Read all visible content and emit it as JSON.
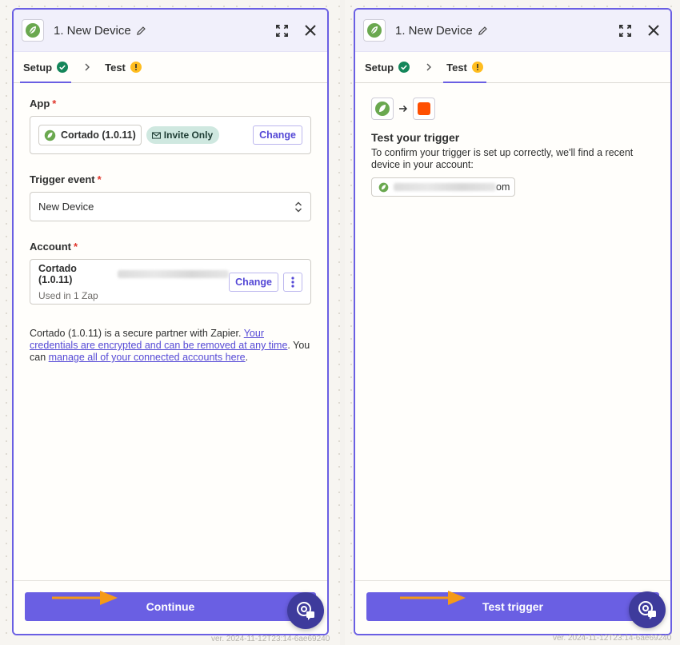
{
  "colors": {
    "accent": "#6a5fe3",
    "success": "#14865a",
    "warning": "#ffbd1f",
    "brand_green": "#6aa84f",
    "orange_app": "#ff4f00",
    "annotation_arrow": "#f59a18"
  },
  "left_panel": {
    "header": {
      "title": "1. New Device",
      "expand_icon": "expand-icon",
      "close_icon": "close-icon"
    },
    "tabs": [
      {
        "label": "Setup",
        "status": "complete"
      },
      {
        "label": "Test",
        "status": "warning"
      }
    ],
    "app": {
      "label": "App",
      "name": "Cortado (1.0.11)",
      "badge": "Invite Only",
      "change_label": "Change"
    },
    "trigger": {
      "label": "Trigger event",
      "value": "New Device"
    },
    "account": {
      "label": "Account",
      "name": "Cortado (1.0.11)",
      "usage": "Used in 1 Zap",
      "change_label": "Change"
    },
    "info": {
      "text_1": "Cortado (1.0.11) is a secure partner with Zapier. ",
      "link_1": "Your credentials are encrypted and can be removed at any time",
      "text_2": ". You can ",
      "link_2": "manage all of your connected accounts here",
      "text_3": "."
    },
    "footer": {
      "button_label": "Continue",
      "version": "ver. 2024-11-12T23:14-6ae69240"
    }
  },
  "right_panel": {
    "header": {
      "title": "1. New Device",
      "expand_icon": "expand-icon",
      "close_icon": "close-icon"
    },
    "tabs": [
      {
        "label": "Setup",
        "status": "complete"
      },
      {
        "label": "Test",
        "status": "warning"
      }
    ],
    "test": {
      "title": "Test your trigger",
      "description": "To confirm your trigger is set up correctly, we'll find a recent device in your account:",
      "email_suffix": "om"
    },
    "footer": {
      "button_label": "Test trigger",
      "version": "ver. 2024-11-12T23:14-6ae69240"
    }
  }
}
